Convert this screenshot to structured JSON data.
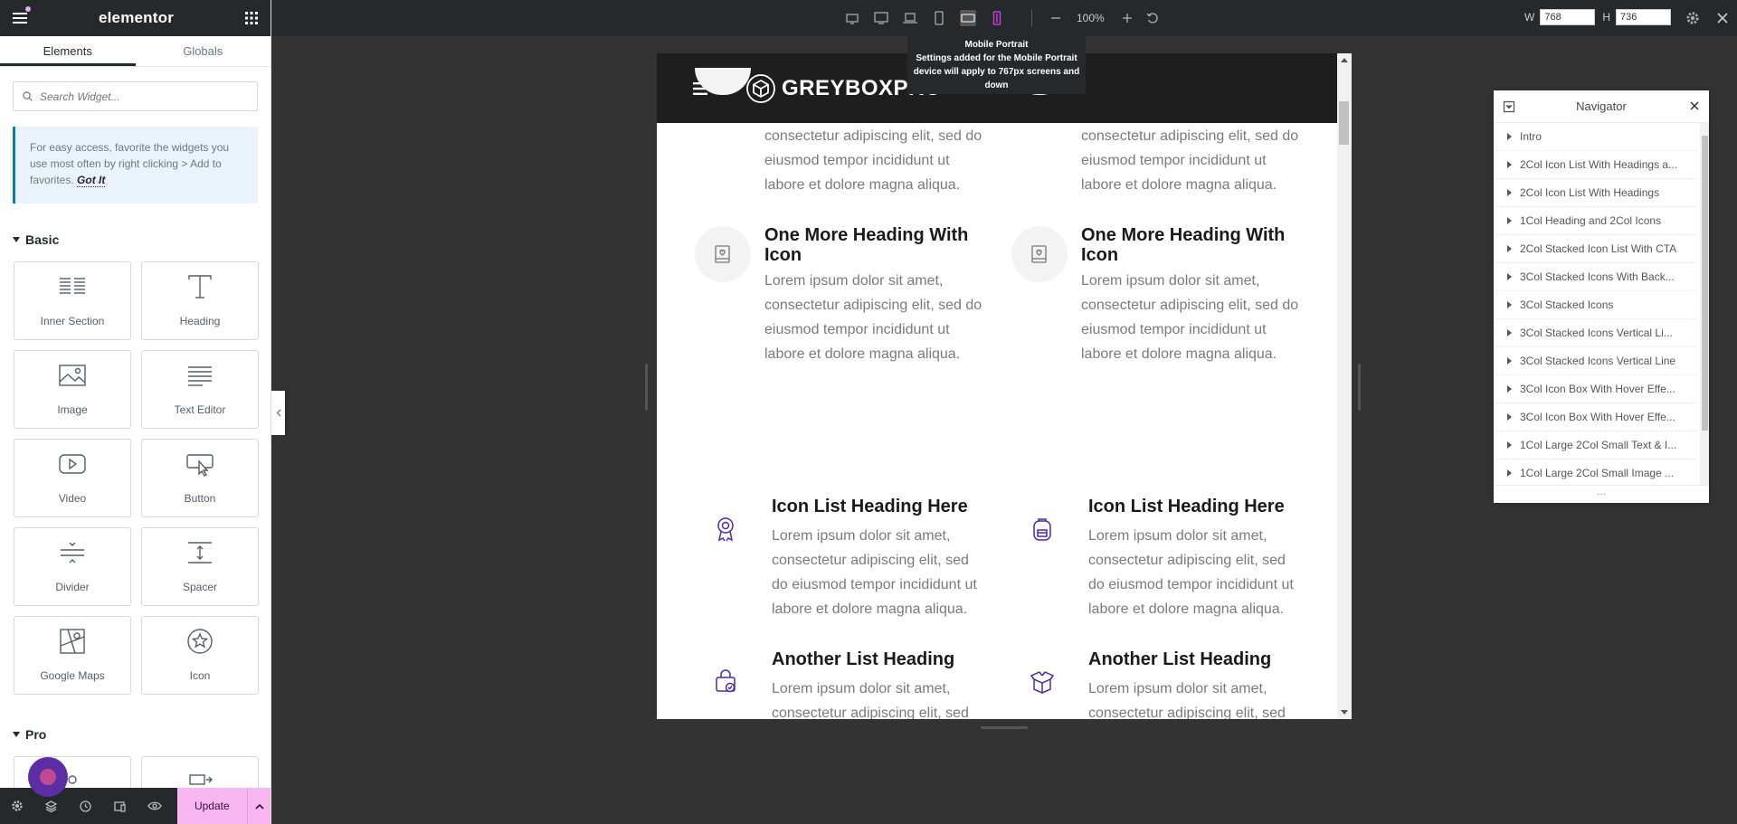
{
  "panel": {
    "logo": "elementor",
    "tabs": [
      {
        "label": "Elements"
      },
      {
        "label": "Globals"
      }
    ],
    "search_placeholder": "Search Widget...",
    "tip": {
      "text": "For easy access, favorite the widgets you use most often by right clicking > Add to favorites.",
      "link": "Got It"
    },
    "basic_label": "Basic",
    "widgets": [
      {
        "label": "Inner Section",
        "icon": "inner-section-icon"
      },
      {
        "label": "Heading",
        "icon": "heading-icon"
      },
      {
        "label": "Image",
        "icon": "image-icon"
      },
      {
        "label": "Text Editor",
        "icon": "text-editor-icon"
      },
      {
        "label": "Video",
        "icon": "video-icon"
      },
      {
        "label": "Button",
        "icon": "button-icon"
      },
      {
        "label": "Divider",
        "icon": "divider-icon"
      },
      {
        "label": "Spacer",
        "icon": "spacer-icon"
      },
      {
        "label": "Google Maps",
        "icon": "google-maps-icon"
      },
      {
        "label": "Icon",
        "icon": "star-icon"
      }
    ],
    "pro_label": "Pro",
    "footer": {
      "update_label": "Update"
    }
  },
  "topbar": {
    "zoom": "100%",
    "width_label": "W",
    "height_label": "H",
    "width_value": "768",
    "height_value": "736"
  },
  "tooltip": {
    "title": "Mobile Portrait",
    "body": "Settings added for the Mobile Portrait device will apply to 767px screens and down"
  },
  "preview": {
    "logo_text": "GREYBOXPRO",
    "top_text": "consectetur adipiscing elit, sed do eiusmod tempor incididunt ut labore et dolore magna aliqua.",
    "heading_a": "One More Heading With Icon",
    "body_a": "Lorem ipsum dolor sit amet, consectetur adipiscing elit, sed do eiusmod tempor incididunt ut labore et dolore magna aliqua.",
    "list_heading_1": "Icon List Heading Here",
    "list_body_1": "Lorem ipsum dolor sit amet, consectetur adipiscing elit, sed do eiusmod tempor incididunt ut labore et dolore magna aliqua.",
    "list_heading_2": "Another List Heading",
    "list_body_2": "Lorem ipsum dolor sit amet, consectetur adipiscing elit, sed",
    "accent": "#4b2ba1"
  },
  "navigator": {
    "title": "Navigator",
    "items": [
      {
        "label": "Intro"
      },
      {
        "label": "2Col Icon List With Headings a..."
      },
      {
        "label": "2Col Icon List With Headings"
      },
      {
        "label": "1Col Heading and 2Col Icons"
      },
      {
        "label": "2Col Stacked Icon List With CTA"
      },
      {
        "label": "3Col Stacked Icons With Back..."
      },
      {
        "label": "3Col Stacked Icons"
      },
      {
        "label": "3Col Stacked Icons Vertical Li..."
      },
      {
        "label": "3Col Stacked Icons Vertical Line"
      },
      {
        "label": "3Col Icon Box With Hover Effe..."
      },
      {
        "label": "3Col Icon Box With Hover Effe..."
      },
      {
        "label": "1Col Large 2Col Small Text & I..."
      },
      {
        "label": "1Col Large 2Col Small Image ..."
      }
    ],
    "footer": "..."
  }
}
